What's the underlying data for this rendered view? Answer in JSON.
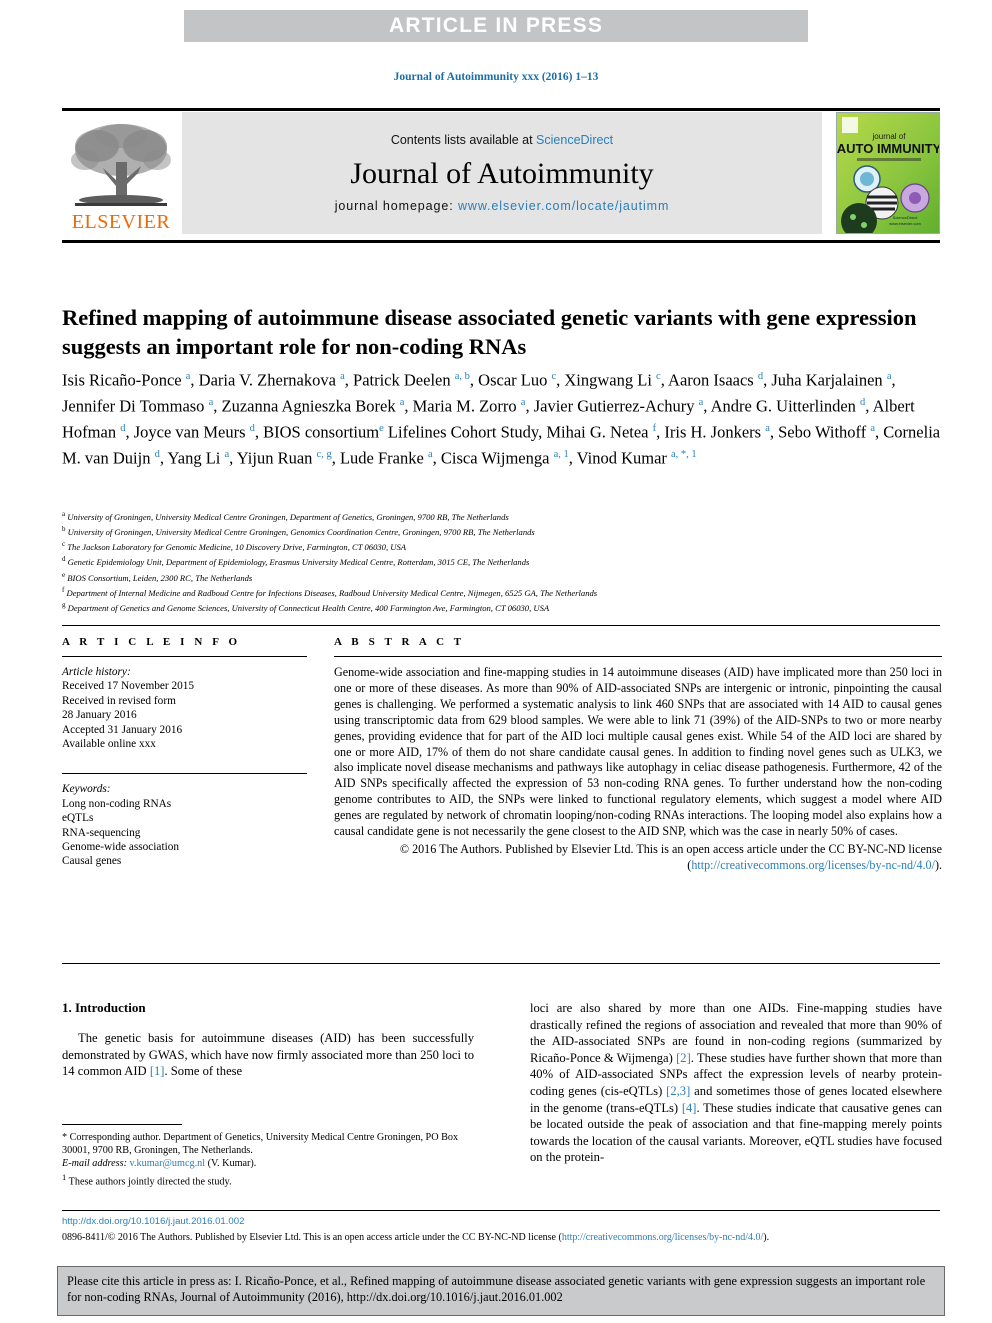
{
  "banner": {
    "text": "ARTICLE IN PRESS"
  },
  "running_head": {
    "text": "Journal of Autoimmunity xxx (2016) 1–13"
  },
  "masthead": {
    "contents_prefix": "Contents lists available at ",
    "contents_link": "ScienceDirect",
    "journal_title": "Journal of Autoimmunity",
    "homepage_prefix": "journal homepage: ",
    "homepage_link": "www.elsevier.com/locate/jautimm",
    "publisher_logo_text": "ELSEVIER",
    "cover": {
      "line1": "journal of",
      "line2": "AUTO IMMUNITY"
    }
  },
  "article": {
    "title": "Refined mapping of autoimmune disease associated genetic variants with gene expression suggests an important role for non-coding RNAs",
    "authors_html": "Isis Ricaño-Ponce <sup>a</sup>, Daria V. Zhernakova <sup>a</sup>, Patrick Deelen <sup>a, b</sup>, Oscar Luo <sup>c</sup>, Xingwang Li <sup>c</sup>, Aaron Isaacs <sup>d</sup>, Juha Karjalainen <sup>a</sup>, Jennifer Di Tommaso <sup>a</sup>, Zuzanna Agnieszka Borek <sup>a</sup>, Maria M. Zorro <sup>a</sup>, Javier Gutierrez-Achury <sup>a</sup>, Andre G. Uitterlinden <sup>d</sup>, Albert Hofman <sup>d</sup>, Joyce van Meurs <sup>d</sup>, BIOS consortium<sup>e</sup> Lifelines Cohort Study, Mihai G. Netea <sup>f</sup>, Iris H. Jonkers <sup>a</sup>, Sebo Withoff <sup>a</sup>, Cornelia M. van Duijn <sup>d</sup>, Yang Li <sup>a</sup>, Yijun Ruan <sup>c, g</sup>, Lude Franke <sup>a</sup>, Cisca Wijmenga <sup>a, 1</sup>, Vinod Kumar <sup>a, *, 1</sup>",
    "affiliations": [
      {
        "label": "a",
        "text": "University of Groningen, University Medical Centre Groningen, Department of Genetics, Groningen, 9700 RB, The Netherlands"
      },
      {
        "label": "b",
        "text": "University of Groningen, University Medical Centre Groningen, Genomics Coordination Centre, Groningen, 9700 RB, The Netherlands"
      },
      {
        "label": "c",
        "text": "The Jackson Laboratory for Genomic Medicine, 10 Discovery Drive, Farmington, CT 06030, USA"
      },
      {
        "label": "d",
        "text": "Genetic Epidemiology Unit, Department of Epidemiology, Erasmus University Medical Centre, Rotterdam, 3015 CE, The Netherlands"
      },
      {
        "label": "e",
        "text": "BIOS Consortium, Leiden, 2300 RC, The Netherlands"
      },
      {
        "label": "f",
        "text": "Department of Internal Medicine and Radboud Centre for Infections Diseases, Radboud University Medical Centre, Nijmegen, 6525 GA, The Netherlands"
      },
      {
        "label": "g",
        "text": "Department of Genetics and Genome Sciences, University of Connecticut Health Centre, 400 Farmington Ave, Farmington, CT 06030, USA"
      }
    ]
  },
  "article_info": {
    "heading": "A R T I C L E  I N F O",
    "history_label": "Article history:",
    "history": [
      "Received 17 November 2015",
      "Received in revised form",
      "28 January 2016",
      "Accepted 31 January 2016",
      "Available online xxx"
    ],
    "keywords_label": "Keywords:",
    "keywords": [
      "Long non-coding RNAs",
      "eQTLs",
      "RNA-sequencing",
      "Genome-wide association",
      "Causal genes"
    ]
  },
  "abstract": {
    "heading": "A B S T R A C T",
    "text": "Genome-wide association and fine-mapping studies in 14 autoimmune diseases (AID) have implicated more than 250 loci in one or more of these diseases. As more than 90% of AID-associated SNPs are intergenic or intronic, pinpointing the causal genes is challenging. We performed a systematic analysis to link 460 SNPs that are associated with 14 AID to causal genes using transcriptomic data from 629 blood samples. We were able to link 71 (39%) of the AID-SNPs to two or more nearby genes, providing evidence that for part of the AID loci multiple causal genes exist. While 54 of the AID loci are shared by one or more AID, 17% of them do not share candidate causal genes. In addition to finding novel genes such as ULK3, we also implicate novel disease mechanisms and pathways like autophagy in celiac disease pathogenesis. Furthermore, 42 of the AID SNPs specifically affected the expression of 53 non-coding RNA genes. To further understand how the non-coding genome contributes to AID, the SNPs were linked to functional regulatory elements, which suggest a model where AID genes are regulated by network of chromatin looping/non-coding RNAs interactions. The looping model also explains how a causal candidate gene is not necessarily the gene closest to the AID SNP, which was the case in nearly 50% of cases.",
    "copyright_prefix": "© 2016 The Authors. Published by Elsevier Ltd. This is an open access article under the CC BY-NC-ND license (",
    "copyright_link": "http://creativecommons.org/licenses/by-nc-nd/4.0/",
    "copyright_suffix": ")."
  },
  "introduction": {
    "heading": "1. Introduction",
    "left_para": "The genetic basis for autoimmune diseases (AID) has been successfully demonstrated by GWAS, which have now firmly associated more than 250 loci to 14 common AID ",
    "left_ref": "[1]",
    "left_para_tail": ". Some of these",
    "right_parts": [
      {
        "t": "loci are also shared by more than one AIDs. Fine-mapping studies have drastically refined the regions of association and revealed that more than 90% of the AID-associated SNPs are found in non-coding regions (summarized by Ricaño-Ponce & Wijmenga) "
      },
      {
        "r": "[2]"
      },
      {
        "t": ". These studies have further shown that more than 40% of AID-associated SNPs affect the expression levels of nearby protein-coding genes (cis-eQTLs) "
      },
      {
        "r": "[2,3]"
      },
      {
        "t": " and sometimes those of genes located elsewhere in the genome (trans-eQTLs) "
      },
      {
        "r": "[4]"
      },
      {
        "t": ". These studies indicate that causative genes can be located outside the peak of association and that fine-mapping merely points towards the location of the causal variants. Moreover, eQTL studies have focused on the protein-"
      }
    ]
  },
  "footnotes": {
    "corresponding": "* Corresponding author. Department of Genetics, University Medical Centre Groningen, PO Box 30001, 9700 RB, Groningen, The Netherlands.",
    "email_label": "E-mail address:",
    "email": "v.kumar@umcg.nl",
    "email_suffix": " (V. Kumar).",
    "note1_marker": "1",
    "note1": "These authors jointly directed the study."
  },
  "bottom": {
    "doi": "http://dx.doi.org/10.1016/j.jaut.2016.01.002",
    "license_prefix": "0896-8411/© 2016 The Authors. Published by Elsevier Ltd. This is an open access article under the CC BY-NC-ND license (",
    "license_link": "http://creativecommons.org/licenses/by-nc-nd/4.0/",
    "license_suffix": ")."
  },
  "cite_box": {
    "text": "Please cite this article in press as: I. Ricaño-Ponce, et al., Refined mapping of autoimmune disease associated genetic variants with gene expression suggests an important role for non-coding RNAs, Journal of Autoimmunity (2016), http://dx.doi.org/10.1016/j.jaut.2016.01.002"
  },
  "colors": {
    "link": "#2a7fb8",
    "banner_bg": "#c3c4c6",
    "masthead_bg": "#e4e4e4",
    "elsevier_orange": "#eb6a0a",
    "cite_bg": "#c9cacc"
  }
}
